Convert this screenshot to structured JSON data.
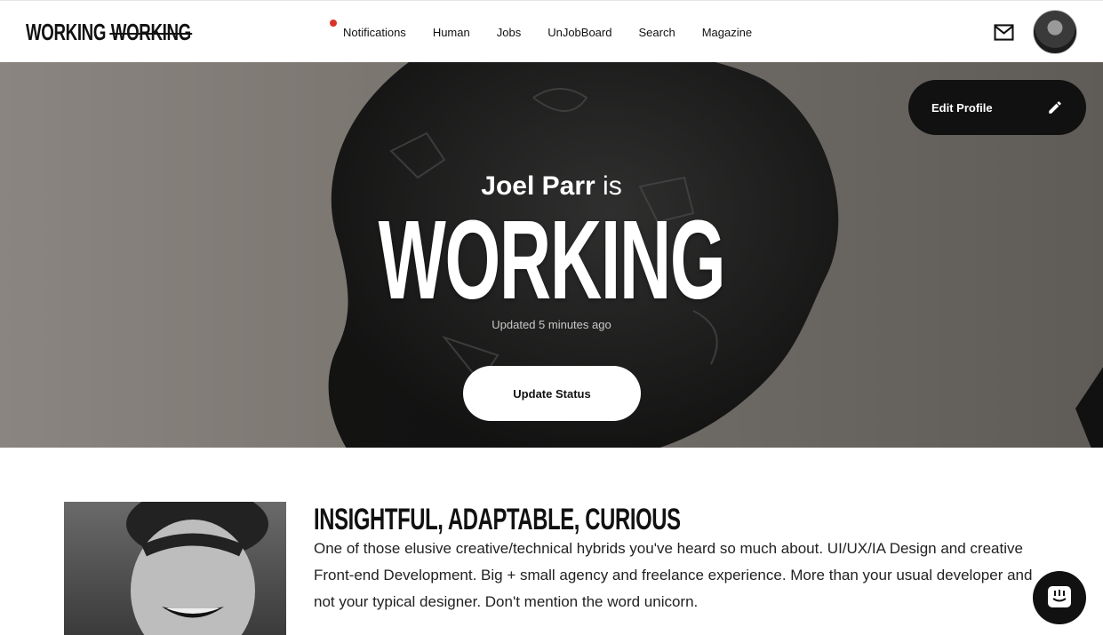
{
  "header": {
    "logo_primary": "WORKING",
    "logo_strike": "WORKING",
    "nav": [
      {
        "label": "Notifications",
        "has_alert": true
      },
      {
        "label": "Human"
      },
      {
        "label": "Jobs"
      },
      {
        "label": "UnJobBoard"
      },
      {
        "label": "Search"
      },
      {
        "label": "Magazine"
      }
    ],
    "mail_icon": "mail-icon",
    "avatar_icon": "user-avatar"
  },
  "hero": {
    "name": "Joel Parr",
    "connector": "is",
    "status": "WORKING",
    "updated": "Updated 5 minutes ago",
    "update_button": "Update Status",
    "edit_button": "Edit Profile",
    "edit_icon": "pencil-icon"
  },
  "profile": {
    "headline": "INSIGHTFUL, ADAPTABLE, CURIOUS",
    "bio": "One of those elusive creative/technical hybrids you've heard so much about. UI/UX/IA Design and creative Front-end Development. Big + small agency and freelance experience. More than your usual developer and not your typical designer. Don't mention the word unicorn."
  },
  "chat_icon": "chat-icon",
  "colors": {
    "accent_dark": "#111111",
    "alert_dot": "#d9342b",
    "hero_bg": "#7d7872"
  }
}
